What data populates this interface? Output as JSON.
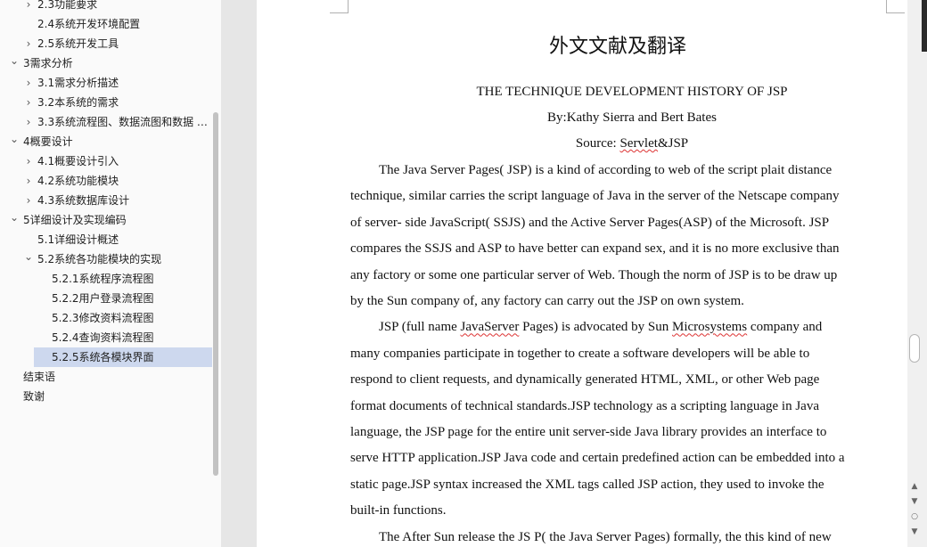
{
  "navigation": {
    "items": [
      {
        "label": "2.3功能要求",
        "level": 1,
        "chevron": "chevron-right-icon",
        "selected": false
      },
      {
        "label": "2.4系统开发环境配置",
        "level": 1,
        "chevron": "",
        "selected": false
      },
      {
        "label": "2.5系统开发工具",
        "level": 1,
        "chevron": "chevron-right-icon",
        "selected": false
      },
      {
        "label": "3需求分析",
        "level": 0,
        "chevron": "chevron-down-icon",
        "selected": false
      },
      {
        "label": "3.1需求分析描述",
        "level": 1,
        "chevron": "chevron-right-icon",
        "selected": false
      },
      {
        "label": "3.2本系统的需求",
        "level": 1,
        "chevron": "chevron-right-icon",
        "selected": false
      },
      {
        "label": "3.3系统流程图、数据流图和数据 …",
        "level": 1,
        "chevron": "chevron-right-icon",
        "selected": false
      },
      {
        "label": "4概要设计",
        "level": 0,
        "chevron": "chevron-down-icon",
        "selected": false
      },
      {
        "label": "4.1概要设计引入",
        "level": 1,
        "chevron": "chevron-right-icon",
        "selected": false
      },
      {
        "label": "4.2系统功能模块",
        "level": 1,
        "chevron": "chevron-right-icon",
        "selected": false
      },
      {
        "label": "4.3系统数据库设计",
        "level": 1,
        "chevron": "chevron-right-icon",
        "selected": false
      },
      {
        "label": "5详细设计及实现编码",
        "level": 0,
        "chevron": "chevron-down-icon",
        "selected": false
      },
      {
        "label": "5.1详细设计概述",
        "level": 1,
        "chevron": "",
        "selected": false
      },
      {
        "label": "5.2系统各功能模块的实现",
        "level": 1,
        "chevron": "chevron-down-icon",
        "selected": false
      },
      {
        "label": "5.2.1系统程序流程图",
        "level": 2,
        "chevron": "",
        "selected": false
      },
      {
        "label": "5.2.2用户登录流程图",
        "level": 2,
        "chevron": "",
        "selected": false
      },
      {
        "label": "5.2.3修改资料流程图",
        "level": 2,
        "chevron": "",
        "selected": false
      },
      {
        "label": "5.2.4查询资料流程图",
        "level": 2,
        "chevron": "",
        "selected": false
      },
      {
        "label": "5.2.5系统各模块界面",
        "level": 2,
        "chevron": "",
        "selected": true
      },
      {
        "label": "结束语",
        "level": 0,
        "chevron": "",
        "selected": false
      },
      {
        "label": "致谢",
        "level": 0,
        "chevron": "",
        "selected": false
      }
    ],
    "selected_color": "#cdd8ee"
  },
  "document": {
    "heading": "外文文献及翻译",
    "article_title": "THE TECHNIQUE DEVELOPMENT HISTORY OF JSP",
    "byline": "By:Kathy Sierra and Bert Bates",
    "source_prefix": "Source: ",
    "source_marked": "Servlet",
    "source_suffix": "&JSP",
    "lines": [
      {
        "indent": true,
        "segments": [
          {
            "t": "The Java Server Pages( JSP) is a kind of according to web of the script plait distance"
          }
        ]
      },
      {
        "indent": false,
        "segments": [
          {
            "t": "technique, similar carries the script language of Java in the server of the Netscape company"
          }
        ]
      },
      {
        "indent": false,
        "segments": [
          {
            "t": "of server- side JavaScript( SSJS) and the Active Server Pages(ASP) of the Microsoft. JSP"
          }
        ]
      },
      {
        "indent": false,
        "segments": [
          {
            "t": "compares the SSJS and ASP to have better can expand sex, and it is no more exclusive than"
          }
        ]
      },
      {
        "indent": false,
        "segments": [
          {
            "t": "any factory or some one particular server of Web. Though the norm of JSP is to be draw up"
          }
        ]
      },
      {
        "indent": false,
        "segments": [
          {
            "t": "by the Sun company of, any factory can carry out the JSP on own system."
          }
        ]
      },
      {
        "indent": true,
        "segments": [
          {
            "t": "JSP (full name "
          },
          {
            "t": "JavaServer",
            "marked": true
          },
          {
            "t": " Pages) is advocated by Sun "
          },
          {
            "t": "Microsystems",
            "marked": true
          },
          {
            "t": " company and"
          }
        ]
      },
      {
        "indent": false,
        "segments": [
          {
            "t": "many companies participate in together to create a software developers will be able to"
          }
        ]
      },
      {
        "indent": false,
        "segments": [
          {
            "t": "respond to client requests, and dynamically generated HTML, XML, or other Web page"
          }
        ]
      },
      {
        "indent": false,
        "segments": [
          {
            "t": "format documents of technical standards.JSP technology as a scripting language in Java"
          }
        ]
      },
      {
        "indent": false,
        "segments": [
          {
            "t": "language, the JSP page for the entire unit server-side Java library provides an interface to"
          }
        ]
      },
      {
        "indent": false,
        "segments": [
          {
            "t": "serve HTTP application.JSP Java code and certain predefined action can be embedded into a"
          }
        ]
      },
      {
        "indent": false,
        "segments": [
          {
            "t": "static page.JSP syntax increased the XML tags called JSP action, they used to invoke the"
          }
        ]
      },
      {
        "indent": false,
        "segments": [
          {
            "t": "built-in functions."
          }
        ]
      },
      {
        "indent": true,
        "segments": [
          {
            "t": "The After Sun release the JS P( the Java Server Pages) formally, the this kind of new"
          }
        ]
      }
    ]
  },
  "scrollbar": {
    "up_icon": "▲",
    "down_icon": "▼",
    "page_icon": "○"
  }
}
